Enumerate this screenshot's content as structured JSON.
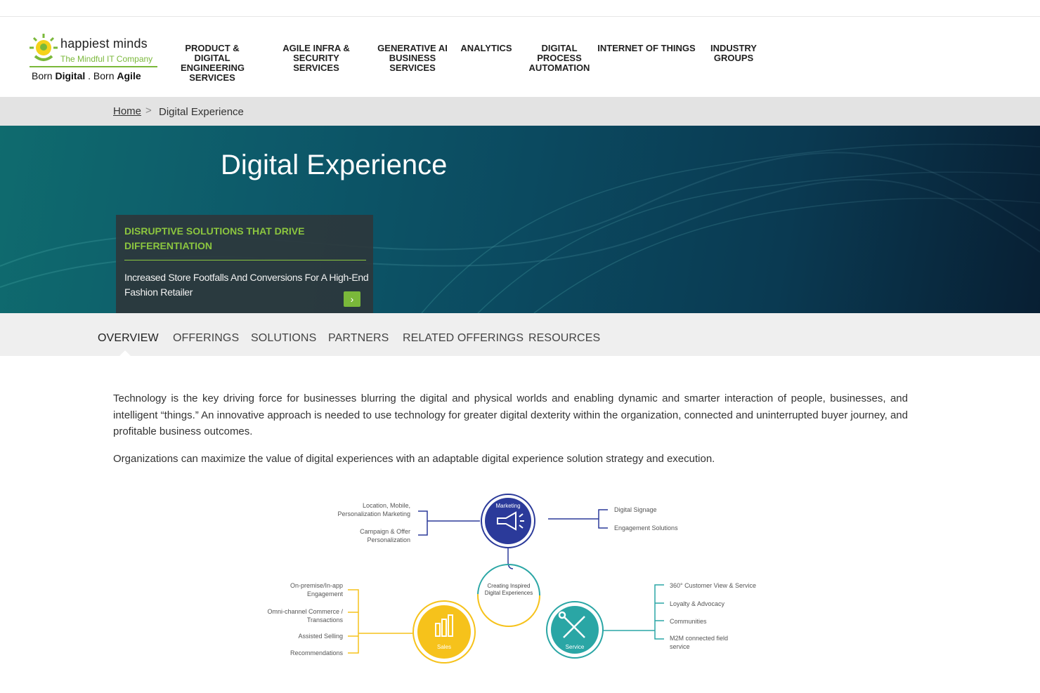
{
  "header": {
    "logo": {
      "brand": "happiest minds",
      "tagline": "The Mindful IT Company",
      "born_1": "Born ",
      "born_digital": "Digital",
      "born_2": " . Born ",
      "born_agile": "Agile"
    },
    "nav": [
      {
        "label": "PRODUCT & DIGITAL ENGINEERING SERVICES"
      },
      {
        "label": "AGILE INFRA & SECURITY SERVICES"
      },
      {
        "label": "GENERATIVE AI BUSINESS SERVICES"
      },
      {
        "label": "ANALYTICS"
      },
      {
        "label": "DIGITAL PROCESS AUTOMATION"
      },
      {
        "label": "INTERNET OF THINGS"
      },
      {
        "label": "INDUSTRY GROUPS"
      }
    ]
  },
  "breadcrumb": {
    "home": "Home",
    "separator": ">",
    "current": "Digital Experience"
  },
  "hero": {
    "title": "Digital Experience",
    "card": {
      "kicker": "DISRUPTIVE SOLUTIONS THAT DRIVE DIFFERENTIATION",
      "description": "Increased Store Footfalls And Conversions For A High-End Fashion Retailer",
      "cta_icon": "chevron-right-icon"
    }
  },
  "tabs": [
    {
      "label": "OVERVIEW",
      "active": true
    },
    {
      "label": "OFFERINGS",
      "active": false
    },
    {
      "label": "SOLUTIONS",
      "active": false
    },
    {
      "label": "PARTNERS",
      "active": false
    },
    {
      "label": "RELATED OFFERINGS",
      "active": false
    },
    {
      "label": "RESOURCES",
      "active": false
    }
  ],
  "content": {
    "paragraph_1": "Technology is the key driving force for businesses blurring the digital and physical worlds and enabling dynamic and smarter interaction of people, businesses, and intelligent “things.” An innovative approach is needed to use technology for greater digital dexterity within the organization, connected and uninterrupted buyer journey, and profitable business outcomes.",
    "paragraph_2": "Organizations can maximize the value of digital experiences with an adaptable digital experience solution strategy and execution."
  },
  "diagram": {
    "marketing": {
      "caption": "Marketing",
      "left": [
        "Location, Mobile, Personalization Marketing",
        "Campaign & Offer Personalization"
      ],
      "right": [
        "Digital Signage",
        "Engagement Solutions"
      ],
      "color": "#2b3a9a"
    },
    "center": {
      "caption": "Creating Inspired Digital Experiences"
    },
    "sales": {
      "caption": "Sales",
      "left": [
        "On-premise/In-app Engagement",
        "Omni-channel Commerce / Transactions",
        "Assisted Selling",
        "Recommendations"
      ],
      "color": "#f6c21b"
    },
    "service": {
      "caption": "Service",
      "right": [
        "360° Customer View & Service",
        "Loyalty & Advocacy",
        "Communities",
        "M2M connected field service"
      ],
      "color": "#2aa6a5"
    }
  },
  "colors": {
    "accent_green": "#8cc63f",
    "hero_dark": "#0a3a52",
    "breadcrumb_bg": "#e3e3e3",
    "tab_bg": "#efefef"
  }
}
